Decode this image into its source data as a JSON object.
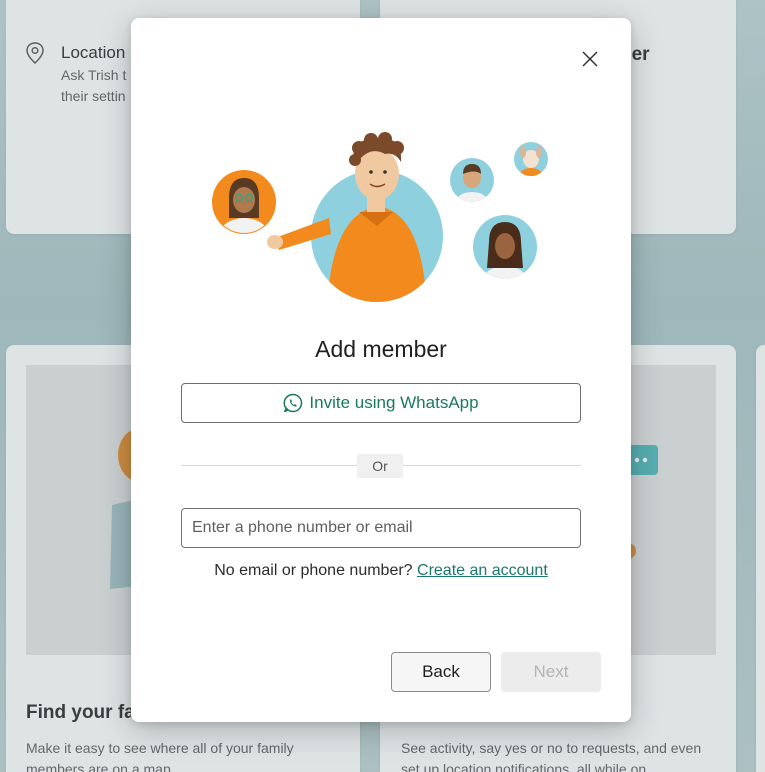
{
  "background": {
    "location_card": {
      "title": "Location",
      "desc_line1": "Ask Trish t",
      "desc_line2": "their settin"
    },
    "right_card_title_fragment": "ber",
    "find_family": {
      "title": "Find your fa",
      "desc": "Make it easy to see where all of your family members are on a map."
    },
    "activity_card": {
      "desc": "See activity, say yes or no to requests, and even set up location notifications, all while on"
    }
  },
  "dialog": {
    "title": "Add member",
    "whatsapp_label": "Invite using WhatsApp",
    "or_label": "Or",
    "input": {
      "placeholder": "Enter a phone number or email",
      "value": ""
    },
    "no_account_text": "No email or phone number?",
    "create_account_link": "Create an account",
    "back_label": "Back",
    "next_label": "Next"
  },
  "colors": {
    "accent_green": "#1a7a5e",
    "illustration_orange": "#f28a1e",
    "illustration_blue": "#8fd0df",
    "disabled_text": "#b3b3b3"
  },
  "icons": {
    "close": "close-icon",
    "whatsapp": "whatsapp-icon",
    "location": "location-pin-icon"
  }
}
